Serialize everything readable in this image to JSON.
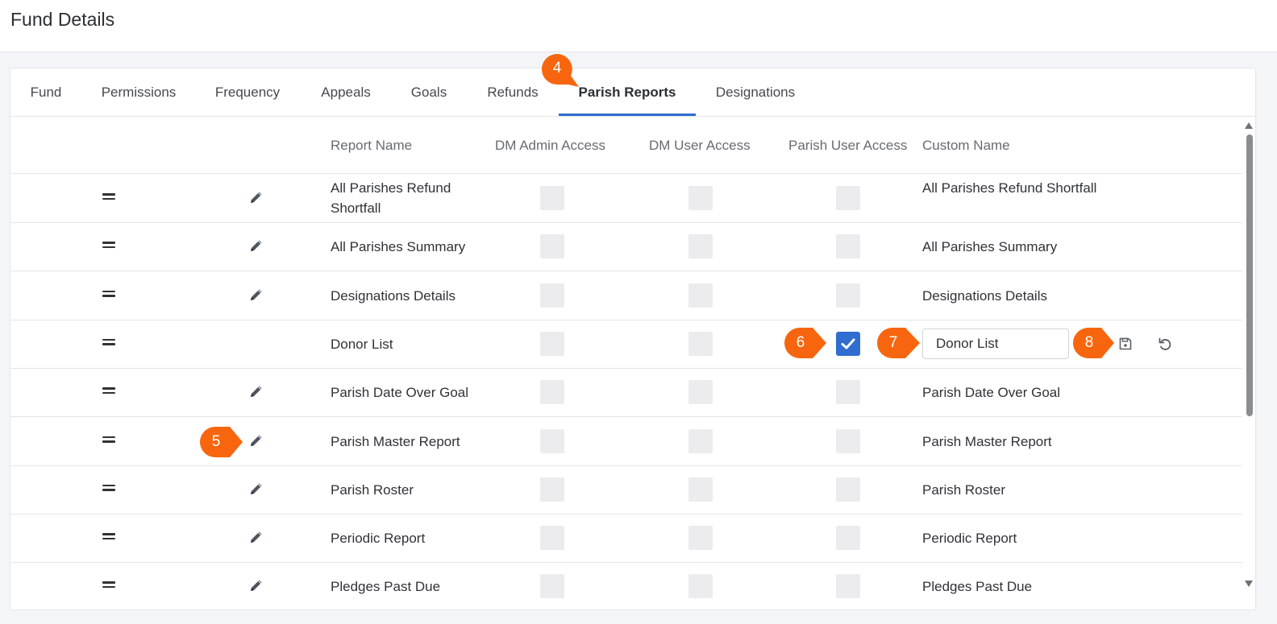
{
  "page": {
    "title": "Fund Details"
  },
  "tabs": [
    {
      "label": "Fund"
    },
    {
      "label": "Permissions"
    },
    {
      "label": "Frequency"
    },
    {
      "label": "Appeals"
    },
    {
      "label": "Goals"
    },
    {
      "label": "Refunds"
    },
    {
      "label": "Parish Reports"
    },
    {
      "label": "Designations"
    }
  ],
  "active_tab": "Parish Reports",
  "columns": {
    "report_name": "Report Name",
    "dm_admin": "DM Admin Access",
    "dm_user": "DM User Access",
    "parish_user": "Parish User Access",
    "custom_name": "Custom Name"
  },
  "rows": [
    {
      "name": "All Parishes Refund Shortfall",
      "custom": "All Parishes Refund Shortfall",
      "dm_admin": false,
      "dm_user": false,
      "parish_user": false
    },
    {
      "name": "All Parishes Summary",
      "custom": "All Parishes Summary",
      "dm_admin": false,
      "dm_user": false,
      "parish_user": false
    },
    {
      "name": "Designations Details",
      "custom": "Designations Details",
      "dm_admin": false,
      "dm_user": false,
      "parish_user": false
    },
    {
      "name": "Donor List",
      "custom": "Donor List",
      "dm_admin": false,
      "dm_user": false,
      "parish_user": true,
      "editing": true
    },
    {
      "name": "Parish Date Over Goal",
      "custom": "Parish Date Over Goal",
      "dm_admin": false,
      "dm_user": false,
      "parish_user": false
    },
    {
      "name": "Parish Master Report",
      "custom": "Parish Master Report",
      "dm_admin": false,
      "dm_user": false,
      "parish_user": false
    },
    {
      "name": "Parish Roster",
      "custom": "Parish Roster",
      "dm_admin": false,
      "dm_user": false,
      "parish_user": false
    },
    {
      "name": "Periodic Report",
      "custom": "Periodic Report",
      "dm_admin": false,
      "dm_user": false,
      "parish_user": false
    },
    {
      "name": "Pledges Past Due",
      "custom": "Pledges Past Due",
      "dm_admin": false,
      "dm_user": false,
      "parish_user": false
    }
  ],
  "callouts": [
    {
      "label": "4"
    },
    {
      "label": "5"
    },
    {
      "label": "6"
    },
    {
      "label": "7"
    },
    {
      "label": "8"
    }
  ],
  "colors": {
    "accent": "#2f6dd0",
    "callout": "#f7660e",
    "checkbox_off": "#ececee"
  },
  "icons": {
    "drag": "drag-handle-icon",
    "edit": "pencil-icon",
    "save": "save-icon",
    "undo": "undo-icon",
    "check": "check-icon"
  }
}
